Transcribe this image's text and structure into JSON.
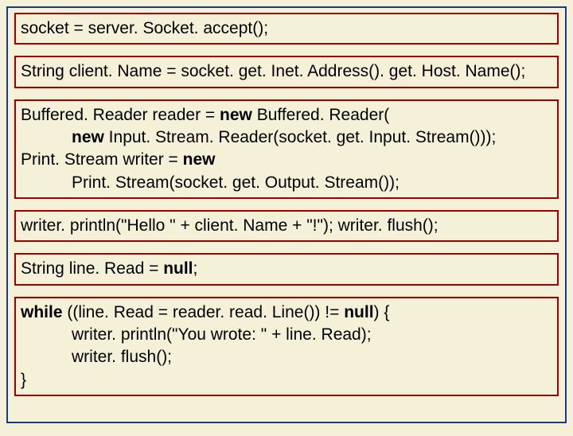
{
  "blocks": {
    "b1": {
      "l1": "socket = server. Socket. accept();"
    },
    "b2": {
      "l1": "String client. Name = socket. get. Inet. Address(). get. Host. Name();"
    },
    "b3": {
      "l1a": "Buffered. Reader reader = ",
      "l1kw": "new",
      "l1b": " Buffered. Reader(",
      "l2kw": "new",
      "l2b": " Input. Stream. Reader(socket. get. Input. Stream()));",
      "l3a": "Print. Stream writer = ",
      "l3kw": "new",
      "l4a": "Print. Stream(socket. get. Output. Stream());"
    },
    "b4": {
      "l1": "writer. println(\"Hello \" + client. Name + \"!\"); writer. flush();"
    },
    "b5": {
      "l1a": "String line. Read = ",
      "l1kw": "null",
      "l1b": ";"
    },
    "b6": {
      "l1kw1": "while",
      "l1a": " ((line. Read = reader. read. Line()) != ",
      "l1kw2": "null",
      "l1b": ") {",
      "l2": "writer. println(\"You wrote: \" + line. Read);",
      "l3": "writer. flush();",
      "l4": "}"
    }
  }
}
